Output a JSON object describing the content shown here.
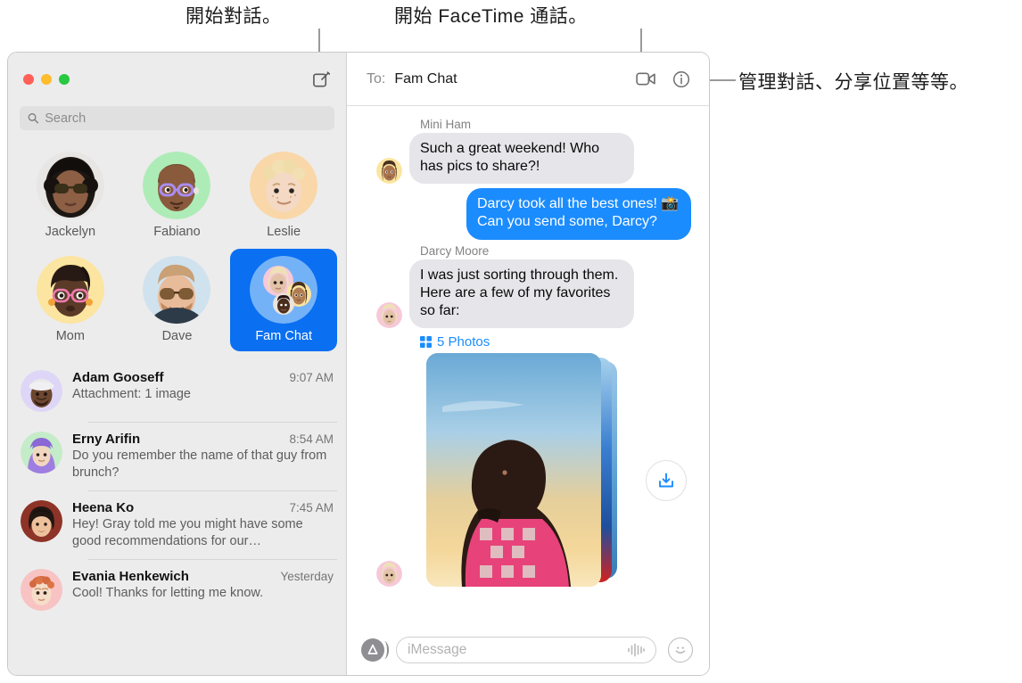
{
  "callouts": [
    {
      "id": "compose",
      "text": "開始對話。"
    },
    {
      "id": "facetime",
      "text": "開始 FaceTime 通話。"
    },
    {
      "id": "details",
      "text": "管理對話、分享位置等等。"
    }
  ],
  "window": {
    "traffic_lights": [
      "close-button",
      "minimize-button",
      "zoom-button"
    ],
    "compose_icon": "compose-icon"
  },
  "search": {
    "placeholder": "Search",
    "value": "",
    "icon": "search-icon"
  },
  "pinned": [
    {
      "label": "Jackelyn",
      "selected": false,
      "avatar": "photo-woman-sunglasses"
    },
    {
      "label": "Fabiano",
      "selected": false,
      "avatar": "memoji-green"
    },
    {
      "label": "Leslie",
      "selected": false,
      "avatar": "memoji-orange"
    },
    {
      "label": "Mom",
      "selected": false,
      "avatar": "memoji-yellow"
    },
    {
      "label": "Dave",
      "selected": false,
      "avatar": "photo-man-sunglasses"
    },
    {
      "label": "Fam Chat",
      "selected": true,
      "avatar": "group-avatar"
    }
  ],
  "conversations": [
    {
      "name": "Adam Gooseff",
      "time": "9:07 AM",
      "snippet": "Attachment: 1 image",
      "avatar": "memoji-lavender"
    },
    {
      "name": "Erny Arifin",
      "time": "8:54 AM",
      "snippet": "Do you remember the name of that guy from brunch?",
      "avatar": "memoji-mint"
    },
    {
      "name": "Heena Ko",
      "time": "7:45 AM",
      "snippet": "Hey! Gray told me you might have some good recommendations for our…",
      "avatar": "photo-woman-smiling"
    },
    {
      "name": "Evania Henkewich",
      "time": "Yesterday",
      "snippet": "Cool! Thanks for letting me know.",
      "avatar": "memoji-pink"
    }
  ],
  "thread": {
    "to_label": "To:",
    "to_value": "Fam Chat",
    "facetime_icon": "video-camera-icon",
    "details_icon": "info-icon",
    "messages": [
      {
        "sender": "Mini Ham",
        "direction": "in",
        "text": "Such a great weekend! Who has pics to share?!",
        "avatar": "memoji-yellow-long-hair"
      },
      {
        "sender": "",
        "direction": "out",
        "text": "Darcy took all the best ones! 📸 Can you send some, Darcy?",
        "avatar": ""
      },
      {
        "sender": "Darcy Moore",
        "direction": "in",
        "text": "I was just sorting through them. Here are a few of my favorites so far:",
        "avatar": "memoji-pink-blonde"
      }
    ],
    "attachment": {
      "label": "5 Photos",
      "grid_icon": "photo-grid-icon",
      "save_icon": "download-icon",
      "accent": "#1b8cfe"
    }
  },
  "composer": {
    "app_icon": "app-store-icon",
    "placeholder": "iMessage",
    "value": "",
    "audio_icon": "audio-waveform-icon",
    "emoji_icon": "emoji-smiley-icon"
  },
  "colors": {
    "accent_blue": "#0a6ff1",
    "bubble_out": "#1b8cfe",
    "bubble_in": "#e6e5ea",
    "sidebar_bg": "#ececec"
  }
}
